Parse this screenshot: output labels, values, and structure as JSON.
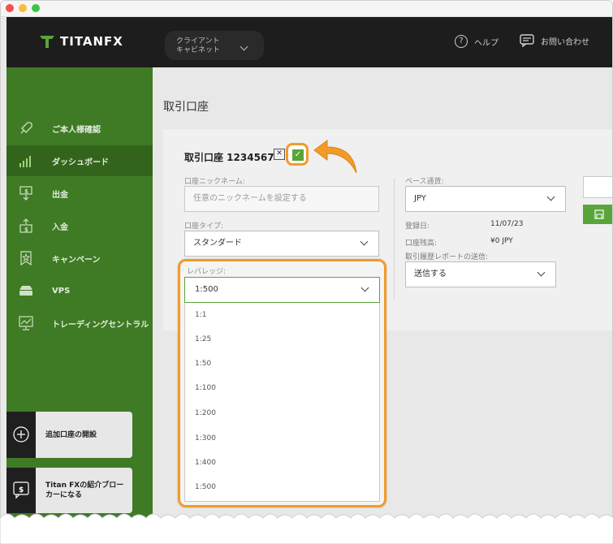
{
  "header": {
    "logo_text": "TITANFX",
    "client_cabinet": [
      "クライアント",
      "キャビネット"
    ],
    "help_label": "ヘルプ",
    "contact_label": "お問い合わせ"
  },
  "sidebar": {
    "items": [
      {
        "label": "ご本人様確認",
        "icon": "rocket-icon"
      },
      {
        "label": "ダッシュボード",
        "icon": "bar-chart-icon",
        "active": true
      },
      {
        "label": "出金",
        "icon": "withdraw-icon"
      },
      {
        "label": "入金",
        "icon": "deposit-icon"
      },
      {
        "label": "キャンペーン",
        "icon": "campaign-icon"
      },
      {
        "label": "VPS",
        "icon": "server-icon"
      },
      {
        "label": "トレーディングセントラル",
        "icon": "monitor-chart-icon"
      }
    ],
    "cards": [
      {
        "label": "追加口座の開設",
        "icon": "plus-circle-icon"
      },
      {
        "label_lines": [
          "Titan FXの紹介ブロー",
          "カーになる"
        ],
        "icon": "dollar-chat-icon"
      }
    ]
  },
  "main": {
    "title": "取引口座",
    "account_title": "取引口座 1234567",
    "x_box": "✕",
    "check_box": "✓",
    "nickname": {
      "label": "口座ニックネーム:",
      "placeholder": "任意のニックネームを設定する"
    },
    "account_type": {
      "label": "口座タイプ:",
      "value": "スタンダード"
    },
    "base_currency": {
      "label": "ベース通貨:",
      "value": "JPY"
    },
    "registered": {
      "label": "登録日:",
      "value": "11/07/23"
    },
    "balance": {
      "label": "口座残高:",
      "value": "¥0 JPY"
    },
    "report": {
      "label": "取引履歴レポートの送信:",
      "value": "送信する"
    },
    "leverage": {
      "label": "レバレッジ:",
      "selected": "1:500",
      "options": [
        "1:1",
        "1:25",
        "1:50",
        "1:100",
        "1:200",
        "1:300",
        "1:400",
        "1:500"
      ]
    }
  },
  "colors": {
    "header_bg": "#1d1d1d",
    "sidebar_green": "#3f7b24",
    "accent_green": "#5aa53a",
    "highlight_orange": "#f29b27"
  }
}
